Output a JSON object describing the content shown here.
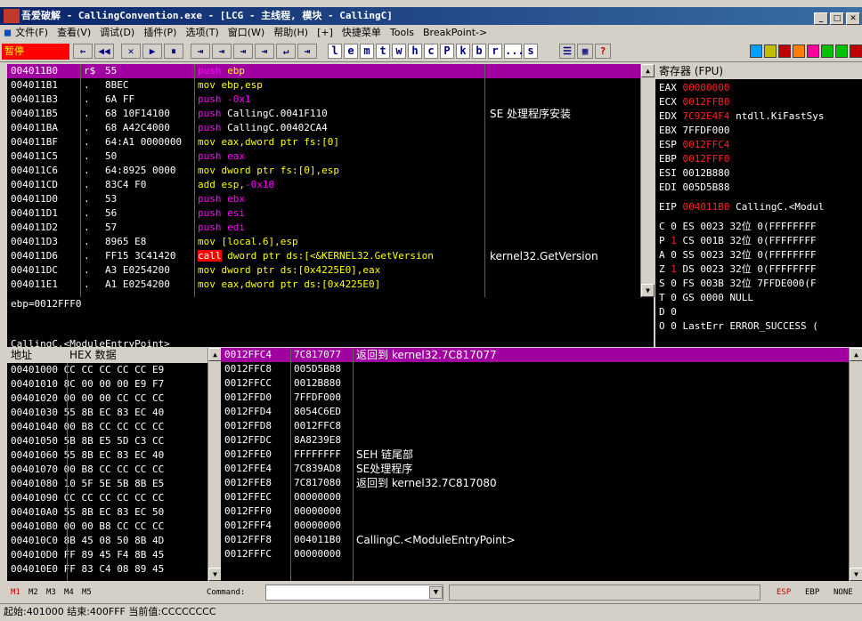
{
  "window": {
    "title": "吾爱破解 - CallingConvention.exe - [LCG - 主线程, 模块 - CallingC]"
  },
  "menu": [
    "文件(F)",
    "查看(V)",
    "调试(D)",
    "插件(P)",
    "选项(T)",
    "窗口(W)",
    "帮助(H)",
    "[+]",
    "快捷菜单",
    "Tools",
    "BreakPoint->"
  ],
  "toolbar": {
    "status": "暂停",
    "buttons": [
      "⇐",
      "◀◀",
      "✕",
      "▶",
      "⏸",
      "⇥",
      "⇥",
      "⇥",
      "⇥",
      "↵",
      "⇥"
    ],
    "letters": [
      "l",
      "e",
      "m",
      "t",
      "w",
      "h",
      "c",
      "P",
      "k",
      "b",
      "r",
      "...",
      "s"
    ],
    "help": "?"
  },
  "disasm": {
    "rows": [
      {
        "addr": "004011B0",
        "mark": "r$",
        "hex": "55",
        "asm": [
          {
            "t": "push",
            "c": "m"
          },
          {
            "t": " ebp",
            "c": "y"
          }
        ],
        "cmt": ""
      },
      {
        "addr": "004011B1",
        "mark": ".",
        "hex": "8BEC",
        "asm": [
          {
            "t": "mov ebp,esp",
            "c": "y"
          }
        ],
        "cmt": ""
      },
      {
        "addr": "004011B3",
        "mark": ".",
        "hex": "6A FF",
        "asm": [
          {
            "t": "push",
            "c": "m"
          },
          {
            "t": " -0x1",
            "c": "m"
          }
        ],
        "cmt": ""
      },
      {
        "addr": "004011B5",
        "mark": ".",
        "hex": "68 10F14100",
        "asm": [
          {
            "t": "push",
            "c": "m"
          },
          {
            "t": " CallingC.0041F110",
            "c": "w"
          }
        ],
        "cmt": "SE 处理程序安装"
      },
      {
        "addr": "004011BA",
        "mark": ".",
        "hex": "68 A42C4000",
        "asm": [
          {
            "t": "push",
            "c": "m"
          },
          {
            "t": " CallingC.00402CA4",
            "c": "w"
          }
        ],
        "cmt": ""
      },
      {
        "addr": "004011BF",
        "mark": ".",
        "hex": "64:A1 0000000",
        "asm": [
          {
            "t": "mov eax,dword ptr fs:[0]",
            "c": "y"
          }
        ],
        "cmt": ""
      },
      {
        "addr": "004011C5",
        "mark": ".",
        "hex": "50",
        "asm": [
          {
            "t": "push",
            "c": "m"
          },
          {
            "t": " eax",
            "c": "m"
          }
        ],
        "cmt": ""
      },
      {
        "addr": "004011C6",
        "mark": ".",
        "hex": "64:8925 0000",
        "asm": [
          {
            "t": "mov dword ptr fs:[0],esp",
            "c": "y"
          }
        ],
        "cmt": ""
      },
      {
        "addr": "004011CD",
        "mark": ".",
        "hex": "83C4 F0",
        "asm": [
          {
            "t": "add esp,",
            "c": "y"
          },
          {
            "t": "-0x10",
            "c": "m"
          }
        ],
        "cmt": ""
      },
      {
        "addr": "004011D0",
        "mark": ".",
        "hex": "53",
        "asm": [
          {
            "t": "push",
            "c": "m"
          },
          {
            "t": " ebx",
            "c": "m"
          }
        ],
        "cmt": ""
      },
      {
        "addr": "004011D1",
        "mark": ".",
        "hex": "56",
        "asm": [
          {
            "t": "push",
            "c": "m"
          },
          {
            "t": " esi",
            "c": "m"
          }
        ],
        "cmt": ""
      },
      {
        "addr": "004011D2",
        "mark": ".",
        "hex": "57",
        "asm": [
          {
            "t": "push",
            "c": "m"
          },
          {
            "t": " edi",
            "c": "m"
          }
        ],
        "cmt": ""
      },
      {
        "addr": "004011D3",
        "mark": ".",
        "hex": "8965 E8",
        "asm": [
          {
            "t": "mov [local.6],esp",
            "c": "y"
          }
        ],
        "cmt": ""
      },
      {
        "addr": "004011D6",
        "mark": ".",
        "hex": "FF15 3C41420",
        "asm": [
          {
            "t": "call",
            "c": "call"
          },
          {
            "t": " dword ptr ds:[<&KERNEL32.GetVersion",
            "c": "y"
          }
        ],
        "cmt": "kernel32.GetVersion"
      },
      {
        "addr": "004011DC",
        "mark": ".",
        "hex": "A3 E0254200",
        "asm": [
          {
            "t": "mov dword ptr ds:[0x4225E0],eax",
            "c": "y"
          }
        ],
        "cmt": ""
      },
      {
        "addr": "004011E1",
        "mark": ".",
        "hex": "A1 E0254200",
        "asm": [
          {
            "t": "mov eax,dword ptr ds:[0x4225E0]",
            "c": "y"
          }
        ],
        "cmt": ""
      }
    ],
    "info": "ebp=0012FFF0",
    "info_footer": "CallingC.<ModuleEntryPoint>"
  },
  "registers": {
    "header": "寄存器 (FPU)",
    "general": [
      {
        "name": "EAX",
        "value": "00000000",
        "red": true,
        "extra": ""
      },
      {
        "name": "ECX",
        "value": "0012FFB0",
        "red": true,
        "extra": ""
      },
      {
        "name": "EDX",
        "value": "7C92E4F4",
        "red": true,
        "extra": " ntdll.KiFastSys"
      },
      {
        "name": "EBX",
        "value": "7FFDF000",
        "red": false,
        "extra": ""
      },
      {
        "name": "ESP",
        "value": "0012FFC4",
        "red": true,
        "extra": ""
      },
      {
        "name": "EBP",
        "value": "0012FFF0",
        "red": true,
        "extra": ""
      },
      {
        "name": "ESI",
        "value": "0012B880",
        "red": false,
        "extra": ""
      },
      {
        "name": "EDI",
        "value": "005D5B88",
        "red": false,
        "extra": ""
      }
    ],
    "eip": {
      "name": "EIP",
      "value": "004011B0",
      "extra": " CallingC.<Modul"
    },
    "flags": [
      {
        "f": "C",
        "v": "0",
        "red": false,
        "seg": "ES 0023 32位 0(FFFFFFFF"
      },
      {
        "f": "P",
        "v": "1",
        "red": true,
        "seg": "CS 001B 32位 0(FFFFFFFF"
      },
      {
        "f": "A",
        "v": "0",
        "red": false,
        "seg": "SS 0023 32位 0(FFFFFFFF"
      },
      {
        "f": "Z",
        "v": "1",
        "red": true,
        "seg": "DS 0023 32位 0(FFFFFFFF"
      },
      {
        "f": "S",
        "v": "0",
        "red": false,
        "seg": "FS 003B 32位 7FFDE000(F"
      },
      {
        "f": "T",
        "v": "0",
        "red": false,
        "seg": "GS 0000 NULL"
      },
      {
        "f": "D",
        "v": "0",
        "red": false,
        "seg": ""
      },
      {
        "f": "O",
        "v": "0",
        "red": false,
        "seg": "LastErr ERROR_SUCCESS ("
      }
    ]
  },
  "dump": {
    "header_addr": "地址",
    "header_hex": "HEX 数据",
    "rows": [
      [
        "00401000",
        "CC",
        "CC",
        "CC",
        "CC",
        "CC",
        "E9"
      ],
      [
        "00401010",
        "8C",
        "00",
        "00",
        "00",
        "E9",
        "F7"
      ],
      [
        "00401020",
        "00",
        "00",
        "00",
        "CC",
        "CC",
        "CC"
      ],
      [
        "00401030",
        "55",
        "8B",
        "EC",
        "83",
        "EC",
        "40"
      ],
      [
        "00401040",
        "00",
        "B8",
        "CC",
        "CC",
        "CC",
        "CC"
      ],
      [
        "00401050",
        "5B",
        "8B",
        "E5",
        "5D",
        "C3",
        "CC"
      ],
      [
        "00401060",
        "55",
        "8B",
        "EC",
        "83",
        "EC",
        "40"
      ],
      [
        "00401070",
        "00",
        "B8",
        "CC",
        "CC",
        "CC",
        "CC"
      ],
      [
        "00401080",
        "10",
        "5F",
        "5E",
        "5B",
        "8B",
        "E5"
      ],
      [
        "00401090",
        "CC",
        "CC",
        "CC",
        "CC",
        "CC",
        "CC"
      ],
      [
        "004010A0",
        "55",
        "8B",
        "EC",
        "83",
        "EC",
        "50"
      ],
      [
        "004010B0",
        "00",
        "00",
        "B8",
        "CC",
        "CC",
        "CC"
      ],
      [
        "004010C0",
        "8B",
        "45",
        "08",
        "50",
        "8B",
        "4D"
      ],
      [
        "004010D0",
        "FF",
        "89",
        "45",
        "F4",
        "8B",
        "45"
      ],
      [
        "004010E0",
        "FF",
        "83",
        "C4",
        "08",
        "89",
        "45"
      ]
    ]
  },
  "stack": {
    "rows": [
      {
        "addr": "0012FFC4",
        "val": "7C817077",
        "cmt": "返回到 kernel32.7C817077",
        "hl": true
      },
      {
        "addr": "0012FFC8",
        "val": "005D5B88",
        "cmt": ""
      },
      {
        "addr": "0012FFCC",
        "val": "0012B880",
        "cmt": ""
      },
      {
        "addr": "0012FFD0",
        "val": "7FFDF000",
        "cmt": ""
      },
      {
        "addr": "0012FFD4",
        "val": "8054C6ED",
        "cmt": ""
      },
      {
        "addr": "0012FFD8",
        "val": "0012FFC8",
        "cmt": ""
      },
      {
        "addr": "0012FFDC",
        "val": "8A8239E8",
        "cmt": ""
      },
      {
        "addr": "0012FFE0",
        "val": "FFFFFFFF",
        "cmt": "SEH 链尾部"
      },
      {
        "addr": "0012FFE4",
        "val": "7C839AD8",
        "cmt": "SE处理程序"
      },
      {
        "addr": "0012FFE8",
        "val": "7C817080",
        "cmt": "返回到 kernel32.7C817080"
      },
      {
        "addr": "0012FFEC",
        "val": "00000000",
        "cmt": ""
      },
      {
        "addr": "0012FFF0",
        "val": "00000000",
        "cmt": ""
      },
      {
        "addr": "0012FFF4",
        "val": "00000000",
        "cmt": ""
      },
      {
        "addr": "0012FFF8",
        "val": "004011B0",
        "cmt": "CallingC.<ModuleEntryPoint>"
      },
      {
        "addr": "0012FFFC",
        "val": "00000000",
        "cmt": ""
      }
    ]
  },
  "commandbar": {
    "marks": [
      "M1",
      "M2",
      "M3",
      "M4",
      "M5"
    ],
    "label": "Command:",
    "right": [
      "ESP",
      "EBP",
      "NONE"
    ]
  },
  "status": "起始:401000 结束:400FFF 当前值:CCCCCCCC",
  "colors": {
    "highlight": "#a000a0",
    "call_bg": "#ff0000",
    "register_red": "#ff2020"
  }
}
